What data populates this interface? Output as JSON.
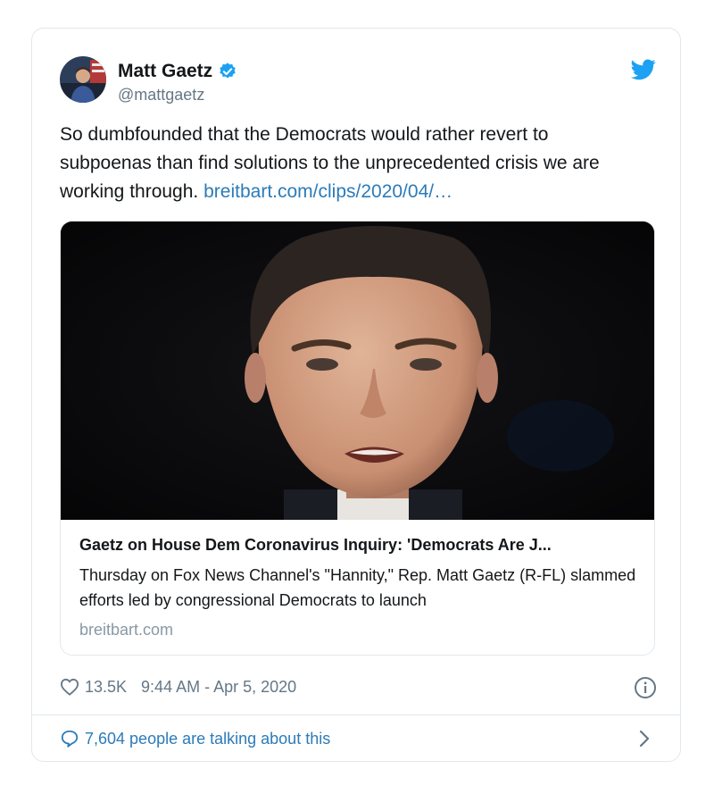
{
  "tweet": {
    "author_name": "Matt Gaetz",
    "handle": "@mattgaetz",
    "text_main": "So dumbfounded that the Democrats would rather revert to subpoenas than find solutions to the unprecedented crisis we are working through.",
    "link_text": "breitbart.com/clips/2020/04/…",
    "icons": {
      "avatar": "avatar",
      "verified": "verified-badge-icon",
      "platform": "twitter-bird-icon",
      "like": "heart-icon",
      "info": "info-icon",
      "talk": "speech-bubble-icon",
      "chevron": "chevron-right-icon"
    },
    "colors": {
      "link": "#2b7bb9",
      "verified": "#1da1f2",
      "muted": "#657786"
    }
  },
  "link_card": {
    "title": "Gaetz on House Dem Coronavirus Inquiry: 'Democrats Are J...",
    "description": "Thursday on Fox News Channel's \"Hannity,\" Rep. Matt Gaetz (R-FL) slammed efforts led by congressional Democrats to launch",
    "domain": "breitbart.com"
  },
  "footer": {
    "like_count": "13.5K",
    "timestamp": "9:44 AM - Apr 5, 2020",
    "talking": "7,604 people are talking about this"
  }
}
